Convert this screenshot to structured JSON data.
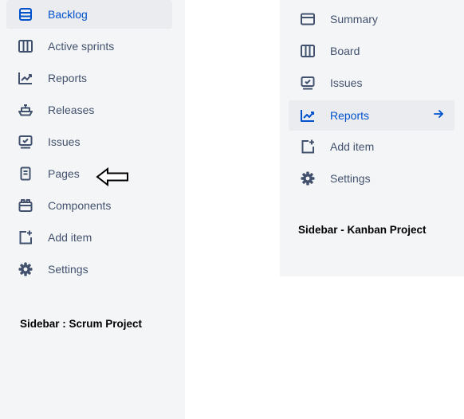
{
  "scrum": {
    "items": [
      {
        "label": "Backlog",
        "icon": "backlog-icon"
      },
      {
        "label": "Active sprints",
        "icon": "columns-icon"
      },
      {
        "label": "Reports",
        "icon": "chart-line-icon"
      },
      {
        "label": "Releases",
        "icon": "ship-icon"
      },
      {
        "label": "Issues",
        "icon": "issues-icon"
      },
      {
        "label": "Pages",
        "icon": "page-icon"
      },
      {
        "label": "Components",
        "icon": "components-icon"
      },
      {
        "label": "Add item",
        "icon": "add-item-icon"
      },
      {
        "label": "Settings",
        "icon": "gear-icon"
      }
    ],
    "caption": "Sidebar : Scrum Project"
  },
  "kanban": {
    "items": [
      {
        "label": "Summary",
        "icon": "summary-icon"
      },
      {
        "label": "Board",
        "icon": "columns-icon"
      },
      {
        "label": "Issues",
        "icon": "issues-icon"
      },
      {
        "label": "Reports",
        "icon": "chart-line-icon"
      },
      {
        "label": "Add item",
        "icon": "add-item-icon"
      },
      {
        "label": "Settings",
        "icon": "gear-icon"
      }
    ],
    "caption": "Sidebar - Kanban Project"
  },
  "colors": {
    "panel_bg": "#f4f5f7",
    "active_bg": "#ebecf0",
    "active_text": "#0052cc",
    "text": "#42526e"
  }
}
